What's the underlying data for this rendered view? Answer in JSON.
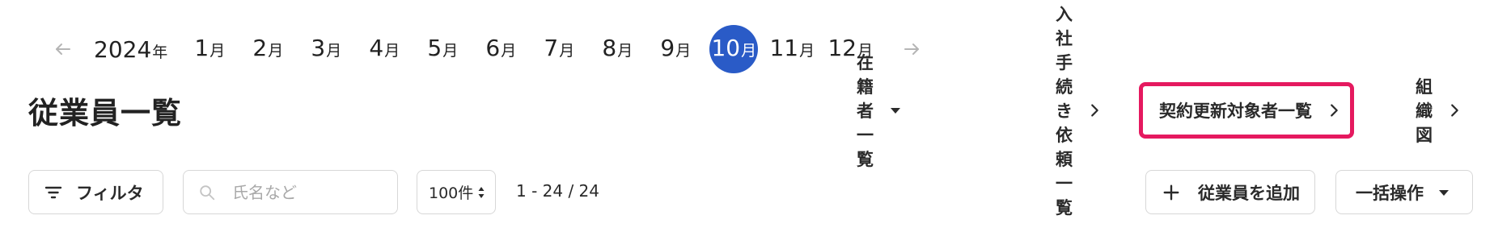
{
  "month_nav": {
    "prev_icon": "arrow-left-icon",
    "next_icon": "arrow-right-icon",
    "year": {
      "num": "2024",
      "unit": "年"
    },
    "months": [
      {
        "num": "1",
        "unit": "月"
      },
      {
        "num": "2",
        "unit": "月"
      },
      {
        "num": "3",
        "unit": "月"
      },
      {
        "num": "4",
        "unit": "月"
      },
      {
        "num": "5",
        "unit": "月"
      },
      {
        "num": "6",
        "unit": "月"
      },
      {
        "num": "7",
        "unit": "月"
      },
      {
        "num": "8",
        "unit": "月"
      },
      {
        "num": "9",
        "unit": "月"
      },
      {
        "num": "10",
        "unit": "月"
      },
      {
        "num": "11",
        "unit": "月"
      },
      {
        "num": "12",
        "unit": "月"
      }
    ],
    "selected_month": "10"
  },
  "header": {
    "title": "従業員一覧",
    "links": {
      "roster": "在籍者一覧",
      "onboarding": "入社手続き依頼一覧",
      "contract_renewal": "契約更新対象者一覧",
      "org_chart": "組織図"
    }
  },
  "toolbar": {
    "filter_label": "フィルタ",
    "search_placeholder": "氏名など",
    "per_page": "100件",
    "range": "1 - 24 / 24",
    "add_label": "従業員を追加",
    "bulk_label": "一括操作"
  },
  "colors": {
    "accent": "#2a5bc7",
    "highlight_border": "#e5195f",
    "text": "#222222",
    "muted": "#a8a8a8"
  }
}
